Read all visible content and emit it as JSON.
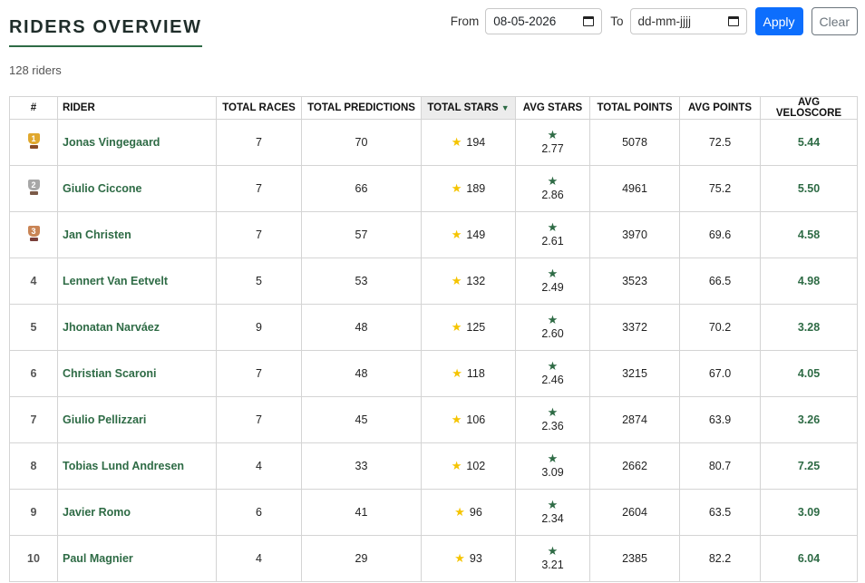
{
  "header": {
    "title": "RIDERS OVERVIEW",
    "count_text": "128 riders"
  },
  "filters": {
    "from_label": "From",
    "from_value": "08-05-2026",
    "to_label": "To",
    "to_placeholder": "dd-mm-jjjj",
    "apply_label": "Apply",
    "clear_label": "Clear"
  },
  "table": {
    "columns": [
      "#",
      "RIDER",
      "TOTAL RACES",
      "TOTAL PREDICTIONS",
      "TOTAL STARS",
      "AVG STARS",
      "TOTAL POINTS",
      "AVG POINTS",
      "AVG VELOSCORE"
    ],
    "sorted_column": "TOTAL STARS",
    "sort_direction": "descending",
    "rows": [
      {
        "rank": "1",
        "rider": "Jonas Vingegaard",
        "races": "7",
        "predictions": "70",
        "stars": "194",
        "avg_stars": "2.77",
        "points": "5078",
        "avg_points": "72.5",
        "veloscore": "5.44"
      },
      {
        "rank": "2",
        "rider": "Giulio Ciccone",
        "races": "7",
        "predictions": "66",
        "stars": "189",
        "avg_stars": "2.86",
        "points": "4961",
        "avg_points": "75.2",
        "veloscore": "5.50"
      },
      {
        "rank": "3",
        "rider": "Jan Christen",
        "races": "7",
        "predictions": "57",
        "stars": "149",
        "avg_stars": "2.61",
        "points": "3970",
        "avg_points": "69.6",
        "veloscore": "4.58"
      },
      {
        "rank": "4",
        "rider": "Lennert Van Eetvelt",
        "races": "5",
        "predictions": "53",
        "stars": "132",
        "avg_stars": "2.49",
        "points": "3523",
        "avg_points": "66.5",
        "veloscore": "4.98"
      },
      {
        "rank": "5",
        "rider": "Jhonatan Narváez",
        "races": "9",
        "predictions": "48",
        "stars": "125",
        "avg_stars": "2.60",
        "points": "3372",
        "avg_points": "70.2",
        "veloscore": "3.28"
      },
      {
        "rank": "6",
        "rider": "Christian Scaroni",
        "races": "7",
        "predictions": "48",
        "stars": "118",
        "avg_stars": "2.46",
        "points": "3215",
        "avg_points": "67.0",
        "veloscore": "4.05"
      },
      {
        "rank": "7",
        "rider": "Giulio Pellizzari",
        "races": "7",
        "predictions": "45",
        "stars": "106",
        "avg_stars": "2.36",
        "points": "2874",
        "avg_points": "63.9",
        "veloscore": "3.26"
      },
      {
        "rank": "8",
        "rider": "Tobias Lund Andresen",
        "races": "4",
        "predictions": "33",
        "stars": "102",
        "avg_stars": "3.09",
        "points": "2662",
        "avg_points": "80.7",
        "veloscore": "7.25"
      },
      {
        "rank": "9",
        "rider": "Javier Romo",
        "races": "6",
        "predictions": "41",
        "stars": "96",
        "avg_stars": "2.34",
        "points": "2604",
        "avg_points": "63.5",
        "veloscore": "3.09"
      },
      {
        "rank": "10",
        "rider": "Paul Magnier",
        "races": "4",
        "predictions": "29",
        "stars": "93",
        "avg_stars": "3.21",
        "points": "2385",
        "avg_points": "82.2",
        "veloscore": "6.04"
      }
    ]
  },
  "icons": {
    "rank_1": "gold-trophy-icon",
    "rank_2": "silver-trophy-icon",
    "rank_3": "bronze-trophy-icon",
    "stars": "star-icon",
    "date": "calendar-icon"
  },
  "colors": {
    "accent_green": "#2e6b45",
    "star_gold": "#f5c400",
    "apply_blue": "#0d6efd"
  }
}
